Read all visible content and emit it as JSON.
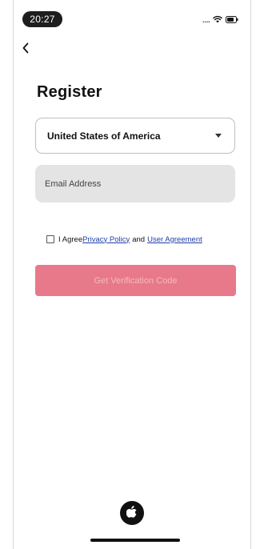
{
  "status_bar": {
    "time": "20:27",
    "signal_text": "....",
    "icons": [
      "wifi-icon",
      "battery-icon"
    ]
  },
  "nav": {
    "back_icon": "chevron-left-icon"
  },
  "page": {
    "title": "Register"
  },
  "form": {
    "country": {
      "selected": "United States of America",
      "icon": "caret-down-icon"
    },
    "email": {
      "placeholder": "Email Address",
      "value": ""
    },
    "agreement": {
      "checked": false,
      "prefix": "I Agree",
      "privacy_link": "Privacy Policy",
      "conjunction": "and",
      "terms_link": "User Agreement"
    },
    "submit_label": "Get Verification Code"
  },
  "footer": {
    "apple_icon": "apple-logo-icon"
  },
  "colors": {
    "accent": "#e8798a",
    "accent_text": "#f4b9c2",
    "link": "#1f3fa8",
    "field_bg": "#e4e4e4"
  }
}
